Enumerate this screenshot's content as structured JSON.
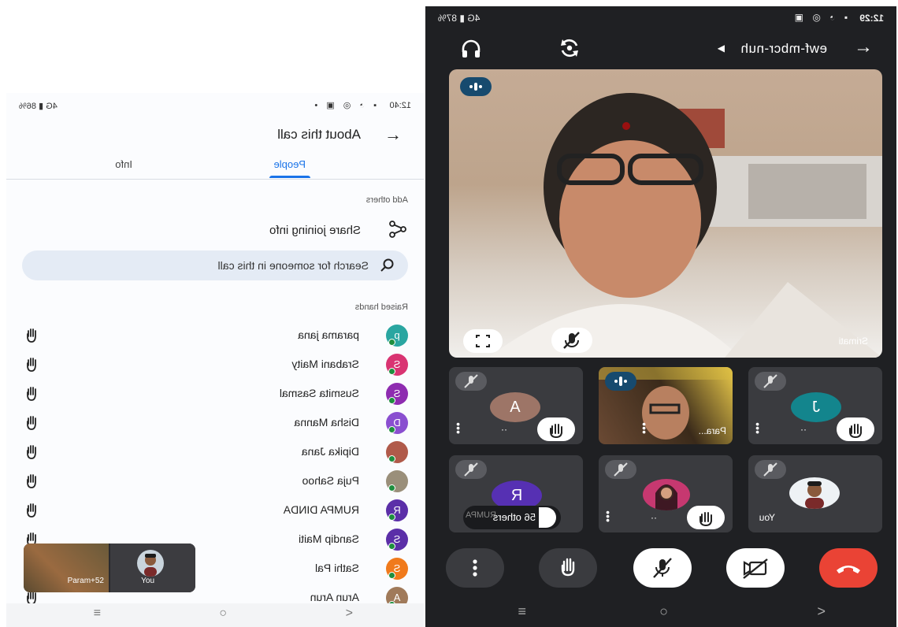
{
  "left": {
    "status": {
      "time": "12:40",
      "network": "4G",
      "battery": "86%"
    },
    "header": {
      "back_icon": "arrow-back-icon",
      "title": "About this call"
    },
    "tabs": [
      {
        "label": "People",
        "active": true
      },
      {
        "label": "Info",
        "active": false
      }
    ],
    "add_others_label": "Add others",
    "share_label": "Share joining info",
    "search_placeholder": "Search for someone in this call",
    "raised_hands_label": "Raised hands",
    "people": [
      {
        "name": "parama jana",
        "initial": "p",
        "color": "#2aa6a1"
      },
      {
        "name": "Srabani Maity",
        "initial": "S",
        "color": "#d93472"
      },
      {
        "name": "Susmita Sasmal",
        "initial": "S",
        "color": "#8e2cb0"
      },
      {
        "name": "Disha Manna",
        "initial": "D",
        "color": "#8a4fd0"
      },
      {
        "name": "Dipika Jana",
        "initial": "",
        "color": "#b05a4a"
      },
      {
        "name": "Puja Sahoo",
        "initial": "",
        "color": "#9a8f7a"
      },
      {
        "name": "RUMPA DINDA",
        "initial": "R",
        "color": "#5b2fa8"
      },
      {
        "name": "Sandip Maiti",
        "initial": "S",
        "color": "#5b2fa8"
      },
      {
        "name": "Sathi Pal",
        "initial": "S",
        "color": "#f07a1c"
      },
      {
        "name": "Arun Arun",
        "initial": "A",
        "color": "#a07a5a"
      }
    ],
    "mini": {
      "you_label": "You",
      "other_label": "Param+52"
    }
  },
  "right": {
    "status": {
      "time": "12:29",
      "network": "4G",
      "battery": "87%"
    },
    "meeting_code": "ewf-mbcr-nuh",
    "main_speaker": "Srimati",
    "tiles": [
      {
        "initial": "J",
        "color": "#13858d"
      },
      {
        "label": "Para..."
      },
      {
        "initial": "A",
        "color": "#9d7567"
      },
      {
        "label": "You"
      },
      {
        "label": ""
      },
      {
        "initial": "R",
        "color": "#5630b3",
        "others": "56 others",
        "footer": "RUMPA"
      }
    ]
  },
  "nav": {
    "back": "<",
    "home": "○",
    "recent": "≡"
  }
}
